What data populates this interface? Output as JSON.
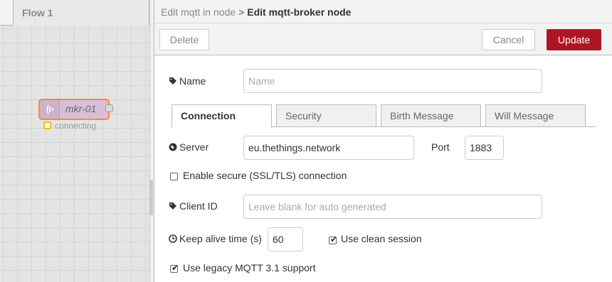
{
  "workspace": {
    "flow_tab": "Flow 1",
    "node": {
      "label": "mkr-01",
      "status": "connecting"
    }
  },
  "tray": {
    "breadcrumb": {
      "previous": "Edit mqtt in node",
      "separator": ">",
      "current": "Edit mqtt-broker node"
    },
    "buttons": {
      "delete": "Delete",
      "cancel": "Cancel",
      "update": "Update"
    },
    "name": {
      "label": "Name",
      "placeholder": "Name"
    },
    "tabs": [
      {
        "label": "Connection",
        "active": true
      },
      {
        "label": "Security",
        "active": false
      },
      {
        "label": "Birth Message",
        "active": false
      },
      {
        "label": "Will Message",
        "active": false
      }
    ],
    "server": {
      "label": "Server",
      "value": "eu.thethings.network"
    },
    "port": {
      "label": "Port",
      "value": "1883"
    },
    "secure": {
      "label": "Enable secure (SSL/TLS) connection",
      "checked": false
    },
    "client_id": {
      "label": "Client ID",
      "placeholder": "Leave blank for auto generated"
    },
    "keepalive": {
      "label": "Keep alive time (s)",
      "value": "60"
    },
    "clean_session": {
      "label": "Use clean session",
      "checked": true
    },
    "legacy": {
      "label": "Use legacy MQTT 3.1 support",
      "checked": true
    }
  },
  "colors": {
    "update_button": "#ad1625",
    "node_fill": "#d8bfd8",
    "node_border": "#ff8a2a",
    "status": "#f0c000"
  },
  "icons": [
    "wifi-icon",
    "tag-icon",
    "globe-icon",
    "clock-icon",
    "check-icon"
  ]
}
